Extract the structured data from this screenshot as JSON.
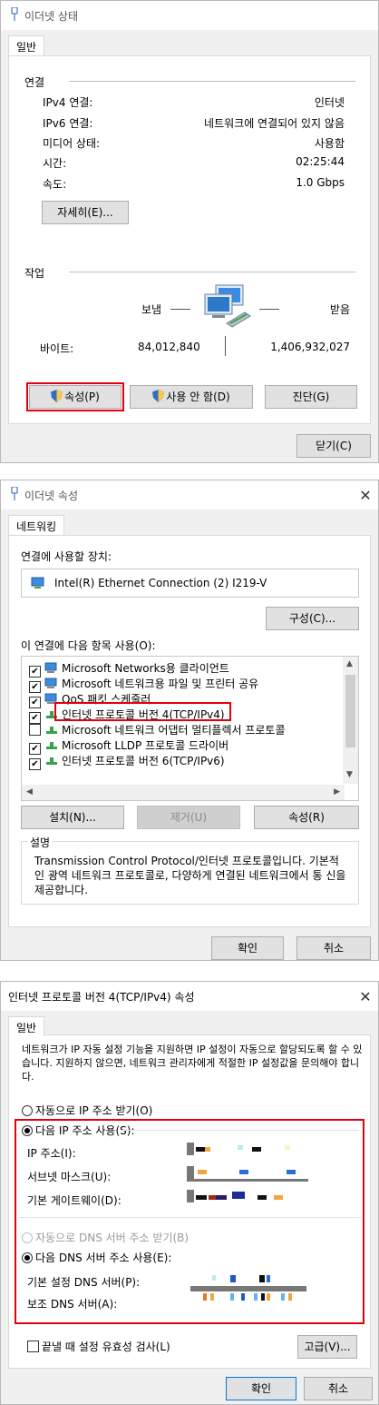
{
  "win1": {
    "title": "이더넷 상태",
    "tab": "일반",
    "conn_section": "연결",
    "rows": [
      {
        "label": "IPv4 연결:",
        "value": "인터넷"
      },
      {
        "label": "IPv6 연결:",
        "value": "네트워크에 연결되어 있지 않음"
      },
      {
        "label": "미디어 상태:",
        "value": "사용함"
      },
      {
        "label": "시간:",
        "value": "02:25:44"
      },
      {
        "label": "속도:",
        "value": "1.0 Gbps"
      }
    ],
    "details_btn": "자세히(E)...",
    "activity_section": "작업",
    "sent_label": "보냄",
    "recv_label": "받음",
    "bytes_label": "바이트:",
    "bytes_sent": "84,012,840",
    "bytes_recv": "1,406,932,027",
    "props_btn": "속성(P)",
    "disable_btn": "사용 안 함(D)",
    "diagnose_btn": "진단(G)",
    "close_btn": "닫기(C)"
  },
  "win2": {
    "title": "이더넷 속성",
    "tab": "네트워킹",
    "connect_using_label": "연결에 사용할 장치:",
    "adapter": "Intel(R) Ethernet Connection (2) I219-V",
    "configure_btn": "구성(C)...",
    "items_label": "이 연결에 다음 항목 사용(O):",
    "items": [
      {
        "label": "Microsoft Networks용 클라이언트",
        "checked": true
      },
      {
        "label": "Microsoft 네트워크용 파일 및 프린터 공유",
        "checked": true
      },
      {
        "label": "QoS 패킷 스케줄러",
        "checked": true
      },
      {
        "label": "인터넷 프로토콜 버전 4(TCP/IPv4)",
        "checked": true
      },
      {
        "label": "Microsoft 네트워크 어댑터 멀티플렉서 프로토콜",
        "checked": false
      },
      {
        "label": "Microsoft LLDP 프로토콜 드라이버",
        "checked": true
      },
      {
        "label": "인터넷 프로토콜 버전 6(TCP/IPv6)",
        "checked": true
      }
    ],
    "install_btn": "설치(N)...",
    "uninstall_btn": "제거(U)",
    "props_btn": "속성(R)",
    "desc_label": "설명",
    "description": "Transmission Control Protocol/인터넷 프로토콜입니다. 기본적 인 광역 네트워크 프로토콜로, 다양하게 연결된 네트워크에서 통 신을 제공합니다.",
    "ok_btn": "확인",
    "cancel_btn": "취소"
  },
  "win3": {
    "title": "인터넷 프로토콜 버전 4(TCP/IPv4) 속성",
    "tab": "일반",
    "intro": "네트워크가 IP 자동 설정 기능을 지원하면 IP 설정이 자동으로 할당되도록 할 수 있습니다. 지원하지 않으면, 네트워크 관리자에게 적절한 IP 설정값을 문의해야 합니다.",
    "auto_ip": "자동으로 IP 주소 받기(O)",
    "manual_ip": "다음 IP 주소 사용(S):",
    "ip_label": "IP 주소(I):",
    "subnet_label": "서브넷 마스크(U):",
    "gateway_label": "기본 게이트웨이(D):",
    "auto_dns": "자동으로 DNS 서버 주소 받기(B)",
    "manual_dns": "다음 DNS 서버 주소 사용(E):",
    "pref_dns_label": "기본 설정 DNS 서버(P):",
    "alt_dns_label": "보조 DNS 서버(A):",
    "validate_label": "끝낼 때 설정 유효성 검사(L)",
    "advanced_btn": "고급(V)...",
    "ok_btn": "확인",
    "cancel_btn": "취소"
  }
}
